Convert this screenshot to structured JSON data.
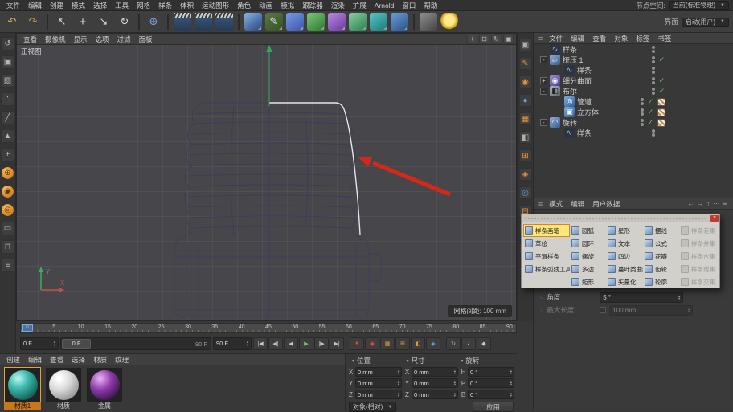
{
  "ui": {
    "burger": "≡",
    "caret": "▼",
    "caret_small": "▾",
    "spin_up": "▴",
    "spin_down": "▾",
    "bullet": "○"
  },
  "window": {
    "menus": [
      "文件",
      "编辑",
      "创建",
      "模式",
      "选择",
      "工具",
      "网格",
      "样条",
      "体积",
      "运动图形",
      "角色",
      "动画",
      "模拟",
      "跟踪器",
      "渲染",
      "扩展",
      "Arnold",
      "窗口",
      "帮助"
    ],
    "node_space_label": "节点空间:",
    "node_space_value": "当前(标准物理)",
    "layout_label": "界面",
    "layout_value": "启动(用户)"
  },
  "toolbar": {
    "icons": [
      {
        "name": "undo-icon",
        "glyph": "↶",
        "cls": "c-amber",
        "inter": "true"
      },
      {
        "name": "redo-icon",
        "glyph": "↷",
        "cls": "c-amber dim",
        "inter": "true"
      },
      {
        "name": "toolbar-separator",
        "glyph": "",
        "cls": "tb-sep",
        "inter": "false"
      },
      {
        "name": "live-selection-icon",
        "glyph": "↖",
        "cls": "c-white",
        "inter": "true"
      },
      {
        "name": "move-tool-icon",
        "glyph": "+",
        "cls": "c-white big",
        "inter": "true"
      },
      {
        "name": "scale-tool-icon",
        "glyph": "↘",
        "cls": "c-white",
        "inter": "true"
      },
      {
        "name": "rotate-tool-icon",
        "glyph": "↻",
        "cls": "c-white",
        "inter": "true"
      },
      {
        "name": "toolbar-separator",
        "glyph": "",
        "cls": "tb-sep",
        "inter": "false"
      },
      {
        "name": "coordinate-system-icon",
        "glyph": "⊕",
        "cls": "c-blue",
        "inter": "true"
      },
      {
        "name": "toolbar-separator",
        "glyph": "",
        "cls": "tb-sep",
        "inter": "false"
      },
      {
        "name": "render-view-icon",
        "glyph": "",
        "cls": "ic-clapper",
        "inter": "true"
      },
      {
        "name": "render-picture-viewer-icon",
        "glyph": "",
        "cls": "ic-clapper",
        "inter": "true"
      },
      {
        "name": "render-settings-icon",
        "glyph": "",
        "cls": "ic-clapper",
        "inter": "true"
      },
      {
        "name": "toolbar-separator",
        "glyph": "",
        "cls": "tb-sep",
        "inter": "false"
      },
      {
        "name": "primitive-cube-icon",
        "glyph": "",
        "cls": "ic-obj ic-cubeblue more",
        "inter": "true"
      },
      {
        "name": "spline-pen-icon",
        "glyph": "✎",
        "cls": "ic-obj ic-pen more",
        "inter": "true"
      },
      {
        "name": "subdivision-surface-icon",
        "glyph": "",
        "cls": "ic-obj ic-sdsblue more",
        "inter": "true"
      },
      {
        "name": "symmetry-icon",
        "glyph": "",
        "cls": "ic-obj ic-sym more",
        "inter": "true"
      },
      {
        "name": "bend-deformer-icon",
        "glyph": "",
        "cls": "ic-obj ic-bend more",
        "inter": "true"
      },
      {
        "name": "cloner-icon",
        "glyph": "",
        "cls": "ic-obj ic-cloner more",
        "inter": "true"
      },
      {
        "name": "field-icon",
        "glyph": "",
        "cls": "ic-obj ic-field more",
        "inter": "true"
      },
      {
        "name": "volume-icon",
        "glyph": "",
        "cls": "ic-obj ic-vol more",
        "inter": "true"
      },
      {
        "name": "toolbar-separator",
        "glyph": "",
        "cls": "tb-sep",
        "inter": "false"
      },
      {
        "name": "camera-icon",
        "glyph": "",
        "cls": "ic-obj ic-cam",
        "inter": "true"
      },
      {
        "name": "light-icon",
        "glyph": "",
        "cls": "ic-obj ic-light",
        "inter": "true"
      }
    ]
  },
  "left_toolbar": {
    "icons": [
      {
        "name": "make-editable-icon",
        "glyph": "↺",
        "cls": ""
      },
      {
        "name": "model-mode-icon",
        "glyph": "▣",
        "cls": ""
      },
      {
        "name": "texture-mode-icon",
        "glyph": "▨",
        "cls": ""
      },
      {
        "name": "points-mode-icon",
        "glyph": "∴",
        "cls": ""
      },
      {
        "name": "edges-mode-icon",
        "glyph": "╱",
        "cls": ""
      },
      {
        "name": "polygons-mode-icon",
        "glyph": "▲",
        "cls": ""
      },
      {
        "name": "tweak-mode-icon",
        "glyph": "+",
        "cls": ""
      },
      {
        "name": "enable-axis-icon",
        "glyph": "⊕",
        "cls": "c-orangecirc"
      },
      {
        "name": "viewport-solo-icon",
        "glyph": "◉",
        "cls": "c-orangecirc"
      },
      {
        "name": "snap-icon",
        "glyph": "◎",
        "cls": "c-orangecirc"
      },
      {
        "name": "workplane-icon",
        "glyph": "▭",
        "cls": ""
      },
      {
        "name": "lock-workplane-icon",
        "glyph": "⊓",
        "cls": ""
      },
      {
        "name": "quantize-icon",
        "glyph": "≡",
        "cls": ""
      }
    ]
  },
  "side_strip": {
    "icons": [
      {
        "name": "palette-cube-icon",
        "glyph": "▣",
        "cls": "s-gray"
      },
      {
        "name": "palette-pen-icon",
        "glyph": "✎",
        "cls": "s-orange"
      },
      {
        "name": "palette-material-icon",
        "glyph": "◉",
        "cls": "s-orange"
      },
      {
        "name": "palette-light-icon",
        "glyph": "●",
        "cls": "s-blue"
      },
      {
        "name": "palette-camera-icon",
        "glyph": "▦",
        "cls": "s-orange"
      },
      {
        "name": "palette-render-icon",
        "glyph": "◧",
        "cls": "s-gray"
      },
      {
        "name": "palette-mograph-icon",
        "glyph": "⊞",
        "cls": "s-orange"
      },
      {
        "name": "palette-deform-icon",
        "glyph": "◈",
        "cls": "s-orange"
      },
      {
        "name": "palette-sim-icon",
        "glyph": "◎",
        "cls": "s-blue"
      },
      {
        "name": "palette-field-icon",
        "glyph": "⊟",
        "cls": "s-orange"
      },
      {
        "name": "palette-tag-icon",
        "glyph": "▤",
        "cls": "s-gray"
      },
      {
        "name": "palette-scene-icon",
        "glyph": "◫",
        "cls": "s-orange"
      }
    ]
  },
  "viewport": {
    "menus": [
      "查看",
      "摄像机",
      "显示",
      "选项",
      "过滤",
      "面板"
    ],
    "nav_icons": [
      {
        "name": "pan-view-icon",
        "glyph": "+"
      },
      {
        "name": "zoom-view-icon",
        "glyph": "⊡"
      },
      {
        "name": "rotate-view-icon",
        "glyph": "↻"
      },
      {
        "name": "toggle-panels-icon",
        "glyph": "▣"
      }
    ],
    "view_label": "正视图",
    "grid_spacing": "网格间距: 100 mm",
    "axis": {
      "x": "X",
      "y": "Y"
    },
    "annotation_arrow_color": "#d42818"
  },
  "object_manager": {
    "menus": [
      "文件",
      "编辑",
      "查看",
      "对象",
      "标签",
      "书签"
    ],
    "items": [
      {
        "name": "tree-item-spline-top",
        "label": "样条",
        "cls": "d0",
        "exp": "",
        "icls": "oi-spline",
        "iglyph": "∿",
        "chk": "",
        "tagcls": ""
      },
      {
        "name": "tree-item-extrude",
        "label": "挤压 1",
        "cls": "d0",
        "exp": "-",
        "icls": "oi-extrude",
        "iglyph": "▱",
        "chk": "✓",
        "tagcls": ""
      },
      {
        "name": "tree-item-extrude-spline",
        "label": "样条",
        "cls": "d1",
        "exp": "",
        "icls": "oi-spline",
        "iglyph": "∿",
        "chk": "",
        "tagcls": ""
      },
      {
        "name": "tree-item-subdivision-surface",
        "label": "细分曲面",
        "cls": "d0",
        "exp": "+",
        "icls": "oi-sds",
        "iglyph": "◉",
        "chk": "✓",
        "tagcls": ""
      },
      {
        "name": "tree-item-boole",
        "label": "布尔",
        "cls": "d0",
        "exp": "-",
        "icls": "oi-boole",
        "iglyph": "◧",
        "chk": "✓",
        "tagcls": ""
      },
      {
        "name": "tree-item-tube",
        "label": "管道",
        "cls": "d1",
        "exp": "",
        "icls": "oi-tube",
        "iglyph": "◎",
        "chk": "✓",
        "tagcls": "show"
      },
      {
        "name": "tree-item-cube",
        "label": "立方体",
        "cls": "d1",
        "exp": "",
        "icls": "oi-cube",
        "iglyph": "▣",
        "chk": "✓",
        "tagcls": "show"
      },
      {
        "name": "tree-item-lathe",
        "label": "旋转",
        "cls": "d0",
        "exp": "-",
        "icls": "oi-lathe",
        "iglyph": "◠",
        "chk": "✓",
        "tagcls": "show"
      },
      {
        "name": "tree-item-lathe-spline",
        "label": "样条",
        "cls": "d1",
        "exp": "",
        "icls": "oi-spline",
        "iglyph": "∿",
        "chk": "",
        "tagcls": ""
      }
    ]
  },
  "attribute_manager": {
    "menus": [
      "模式",
      "编辑",
      "用户数据"
    ],
    "nav_icons": [
      {
        "name": "back-icon",
        "glyph": "←"
      },
      {
        "name": "forward-icon",
        "glyph": "→"
      },
      {
        "name": "up-icon",
        "glyph": "↑"
      },
      {
        "name": "history-icon",
        "glyph": "⋯"
      },
      {
        "name": "lock-icon",
        "glyph": "≡"
      }
    ],
    "rows": [
      {
        "name": "angle-field",
        "label": "角度",
        "value": "5 °",
        "cls": ""
      },
      {
        "name": "max-length-field",
        "label": "最大长度",
        "value": "100 mm",
        "cls": "disabled"
      }
    ]
  },
  "popup": {
    "close_label": "×",
    "items": [
      {
        "name": "spline-pen-item",
        "label": "样条画笔",
        "cls": "highlight"
      },
      {
        "name": "arc-item",
        "label": "圆弧",
        "cls": ""
      },
      {
        "name": "star-item",
        "label": "星形",
        "cls": ""
      },
      {
        "name": "cycloid-item",
        "label": "摆线",
        "cls": ""
      },
      {
        "name": "spline-difference-item",
        "label": "样条差集",
        "cls": "disabled"
      },
      {
        "name": "sketch-item",
        "label": "草绘",
        "cls": ""
      },
      {
        "name": "circle-item",
        "label": "圆环",
        "cls": ""
      },
      {
        "name": "text-item",
        "label": "文本",
        "cls": ""
      },
      {
        "name": "formula-item",
        "label": "公式",
        "cls": ""
      },
      {
        "name": "spline-union-item",
        "label": "样条并集",
        "cls": "disabled"
      },
      {
        "name": "spline-smooth-item",
        "label": "平滑样条",
        "cls": ""
      },
      {
        "name": "helix-item",
        "label": "螺旋",
        "cls": ""
      },
      {
        "name": "four-side-item",
        "label": "四边",
        "cls": ""
      },
      {
        "name": "flower-item",
        "label": "花瓣",
        "cls": ""
      },
      {
        "name": "spline-subtract-item",
        "label": "样条合集",
        "cls": "disabled"
      },
      {
        "name": "spline-arc-tool-item",
        "label": "样条弧线工具",
        "cls": ""
      },
      {
        "name": "n-side-item",
        "label": "多边",
        "cls": ""
      },
      {
        "name": "cissoid-item",
        "label": "蔓叶类曲线",
        "cls": ""
      },
      {
        "name": "cogwheel-item",
        "label": "齿轮",
        "cls": ""
      },
      {
        "name": "spline-or-item",
        "label": "样条或集",
        "cls": "disabled"
      },
      {
        "name": "empty-item",
        "label": "",
        "cls": "empty"
      },
      {
        "name": "rectangle-item",
        "label": "矩形",
        "cls": ""
      },
      {
        "name": "vectorizer-item",
        "label": "矢量化",
        "cls": ""
      },
      {
        "name": "profile-item",
        "label": "轮廓",
        "cls": ""
      },
      {
        "name": "spline-intersect-item",
        "label": "样条交集",
        "cls": "disabled"
      }
    ]
  },
  "timeline": {
    "ruler_labels": [
      "0",
      "5",
      "10",
      "15",
      "20",
      "25",
      "30",
      "35",
      "40",
      "45",
      "50",
      "55",
      "60",
      "65",
      "70",
      "75",
      "80",
      "85",
      "90"
    ],
    "current_frame": "0 F",
    "range_start": "0 F",
    "range_end": "90 F",
    "end_frame": "90 F",
    "buttons": [
      {
        "name": "goto-start-button",
        "glyph": "|◀",
        "cls": "",
        "inter": "true"
      },
      {
        "name": "prev-key-button",
        "glyph": "◀|",
        "cls": "",
        "inter": "true"
      },
      {
        "name": "prev-frame-button",
        "glyph": "◀",
        "cls": "",
        "inter": "true"
      },
      {
        "name": "play-button",
        "glyph": "▶",
        "cls": "r-green",
        "inter": "true"
      },
      {
        "name": "next-key-button",
        "glyph": "|▶",
        "cls": "",
        "inter": "true"
      },
      {
        "name": "goto-end-button",
        "glyph": "▶|",
        "cls": "",
        "inter": "true"
      },
      {
        "name": "transport-separator",
        "glyph": "",
        "cls": "tsep",
        "inter": "false"
      },
      {
        "name": "record-keyframe-button",
        "glyph": "●",
        "cls": "r-red",
        "inter": "true"
      },
      {
        "name": "autokey-button",
        "glyph": "◉",
        "cls": "r-red",
        "inter": "true"
      },
      {
        "name": "record-position-button",
        "glyph": "▦",
        "cls": "r-orange",
        "inter": "true"
      },
      {
        "name": "record-scale-button",
        "glyph": "⊞",
        "cls": "r-orange",
        "inter": "true"
      },
      {
        "name": "record-rotation-button",
        "glyph": "◧",
        "cls": "r-orange",
        "inter": "true"
      },
      {
        "name": "record-parameter-button",
        "glyph": "◈",
        "cls": "r-blue",
        "inter": "true"
      },
      {
        "name": "transport-separator",
        "glyph": "",
        "cls": "tsep",
        "inter": "false"
      },
      {
        "name": "playback-mode-button",
        "glyph": "↻",
        "cls": "",
        "inter": "true"
      },
      {
        "name": "sound-toggle-button",
        "glyph": "♪",
        "cls": "",
        "inter": "true"
      },
      {
        "name": "keyframe-presets-button",
        "glyph": "◆",
        "cls": "",
        "inter": "true"
      }
    ]
  },
  "materials": {
    "menus": [
      "创建",
      "编辑",
      "查看",
      "选择",
      "材质",
      "纹理"
    ],
    "items": [
      {
        "name": "material-item-1",
        "label": "材质1",
        "cls": "sel",
        "ball": "ball-teal"
      },
      {
        "name": "material-item-2",
        "label": "材质",
        "cls": "",
        "ball": "ball-white"
      },
      {
        "name": "material-item-3",
        "label": "金属",
        "cls": "",
        "ball": "ball-purple"
      }
    ]
  },
  "coordinates": {
    "headers": [
      "位置",
      "尺寸",
      "旋转"
    ],
    "position": [
      {
        "axis": "X",
        "value": "0 mm"
      },
      {
        "axis": "Y",
        "value": "0 mm"
      },
      {
        "axis": "Z",
        "value": "0 mm"
      }
    ],
    "size": [
      {
        "axis": "X",
        "value": "0 mm"
      },
      {
        "axis": "Y",
        "value": "0 mm"
      },
      {
        "axis": "Z",
        "value": "0 mm"
      }
    ],
    "rotation": [
      {
        "axis": "H",
        "value": "0 °"
      },
      {
        "axis": "P",
        "value": "0 °"
      },
      {
        "axis": "B",
        "value": "0 °"
      }
    ],
    "mode_value": "对象(相对)",
    "apply_label": "应用"
  },
  "colors": {
    "highlight_yellow": "#ffe87a",
    "accent_orange": "#e8923a",
    "check_green": "#5ec45e",
    "arrow_red": "#d42818",
    "selected_spline": "#e2e6ee"
  }
}
